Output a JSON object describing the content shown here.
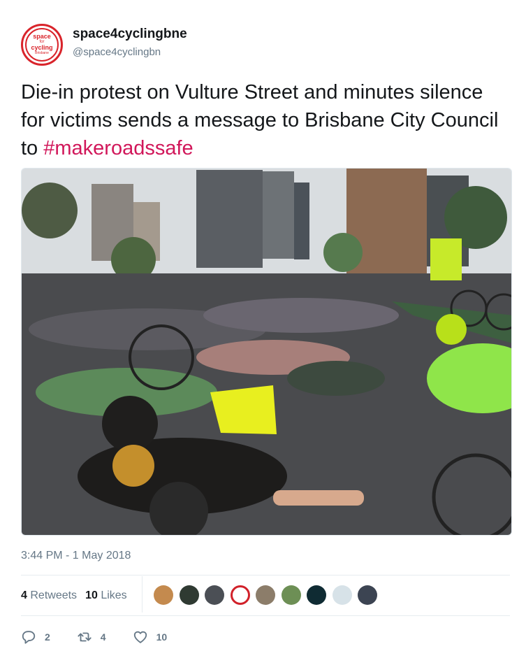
{
  "user": {
    "display_name": "space4cyclingbne",
    "handle": "@space4cyclingbn",
    "avatar_text": [
      "space",
      "for",
      "cycling",
      "Brisbane"
    ]
  },
  "tweet": {
    "text_before": "Die-in protest on Vulture Street and minutes silence for victims sends a message to Brisbane City Council to ",
    "hashtag": "#makeroadssafe"
  },
  "timestamp": "3:44 PM - 1 May 2018",
  "stats": {
    "retweets_count": "4",
    "retweets_label": "Retweets",
    "likes_count": "10",
    "likes_label": "Likes"
  },
  "likers": [
    "liker-1",
    "liker-2",
    "liker-3",
    "liker-4",
    "liker-5",
    "liker-6",
    "liker-7",
    "liker-8",
    "liker-9"
  ],
  "actions": {
    "reply_count": "2",
    "retweet_count": "4",
    "like_count": "10"
  },
  "colors": {
    "hashtag": "#d1175a",
    "secondary_text": "#657786",
    "brand_red": "#d9242b"
  }
}
